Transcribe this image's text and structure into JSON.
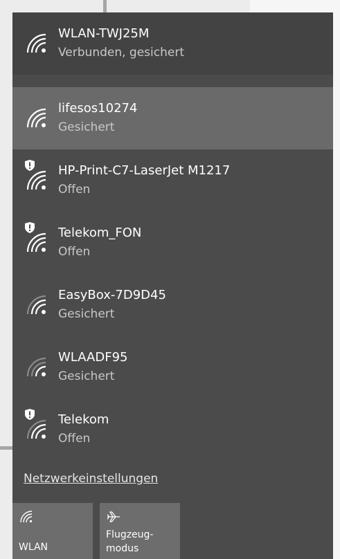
{
  "networks": [
    {
      "name": "WLAN-TWJ25M",
      "status": "Verbunden, gesichert",
      "open": false,
      "state": "connected"
    },
    {
      "name": "lifesos10274",
      "status": "Gesichert",
      "open": false,
      "state": "hovered"
    },
    {
      "name": "HP-Print-C7-LaserJet M1217",
      "status": "Offen",
      "open": true,
      "state": "normal"
    },
    {
      "name": "Telekom_FON",
      "status": "Offen",
      "open": true,
      "state": "normal"
    },
    {
      "name": "EasyBox-7D9D45",
      "status": "Gesichert",
      "open": false,
      "state": "normal"
    },
    {
      "name": "WLAADF95",
      "status": "Gesichert",
      "open": false,
      "state": "normal"
    },
    {
      "name": "Telekom",
      "status": "Offen",
      "open": true,
      "state": "normal"
    }
  ],
  "settings_link": "Netzwerkeinstellungen",
  "quick_actions": [
    {
      "label": "WLAN",
      "icon": "wifi-icon"
    },
    {
      "label": "Flugzeug-\nmodus",
      "label_line1": "Flugzeug-",
      "label_line2": "modus",
      "icon": "airplane-icon"
    }
  ],
  "colors": {
    "flyout_bg": "#4b4b4b",
    "connected_bg": "#434343",
    "hover_bg": "#6a6a6a",
    "tile_bg": "#6d6d6d",
    "status_text": "#c8c8c8"
  }
}
